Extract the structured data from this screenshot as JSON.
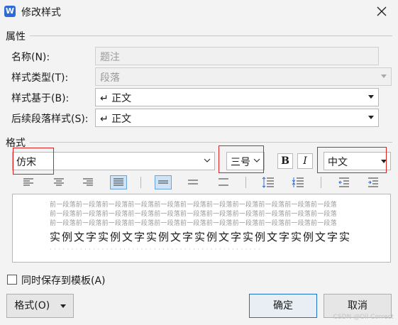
{
  "window": {
    "title": "修改样式",
    "app_icon": "W"
  },
  "properties": {
    "section_title": "属性",
    "name_label": "名称(N):",
    "name_value": "题注",
    "style_type_label": "样式类型(T):",
    "style_type_value": "段落",
    "based_on_label": "样式基于(B):",
    "based_on_value": "↵ 正文",
    "next_style_label": "后续段落样式(S):",
    "next_style_value": "↵ 正文"
  },
  "format": {
    "section_title": "格式",
    "font_name": "仿宋",
    "font_size": "三号",
    "bold_label": "B",
    "italic_label": "I",
    "script": "中文"
  },
  "toolbar_icons": [
    "align-left-icon",
    "align-center-icon",
    "align-right-icon",
    "justify-icon",
    "line-spacing-single-icon",
    "line-spacing-onehalf-icon",
    "line-spacing-double-icon",
    "spacing-increase-icon",
    "spacing-decrease-icon",
    "indent-decrease-icon",
    "indent-increase-icon"
  ],
  "preview": {
    "prev_line": "前一段落前一段落前一段落前一段落前一段落前一段落前一段落前一段落前一段落前一段落前一段落",
    "sample_text": "实例文字实例文字实例文字实例文字实例文字实例文字实",
    "next_line": "· · · · · · · · · · · · · · · · · · · · · · · · · · · · · · · · · · · · · · · · · · · · · · · · ·"
  },
  "options": {
    "save_to_template_label": "同时保存到模板(A)",
    "save_to_template_checked": false
  },
  "buttons": {
    "format": "格式(O)",
    "ok": "确定",
    "cancel": "取消"
  },
  "watermark": "CSDN @Oil Correct",
  "colors": {
    "highlight": "#e02020",
    "accent": "#1e6fc8"
  }
}
